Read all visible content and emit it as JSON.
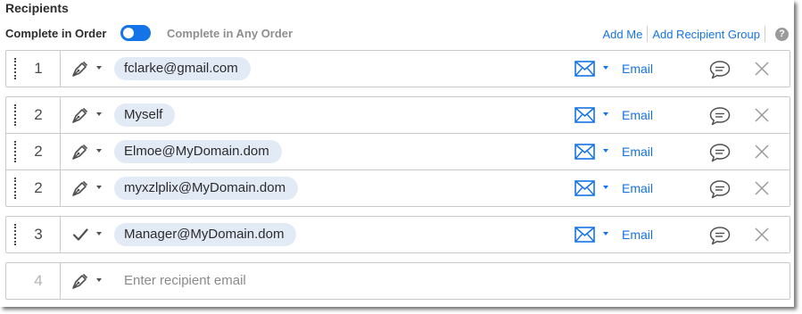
{
  "title": "Recipients",
  "order": {
    "in_order_label": "Complete in Order",
    "any_order_label": "Complete in Any Order"
  },
  "links": {
    "add_me": "Add Me",
    "add_group": "Add Recipient Group",
    "help": "?"
  },
  "colors": {
    "accent": "#1473e6",
    "pill_bg": "#e2eaf6",
    "border": "#c9c9c9"
  },
  "groups": [
    {
      "recipients": [
        {
          "order": "1",
          "role_icon": "signer-pen-icon",
          "email": "fclarke@gmail.com",
          "auth": "Email"
        }
      ]
    },
    {
      "recipients": [
        {
          "order": "2",
          "role_icon": "signer-pen-icon",
          "email": "Myself",
          "auth": "Email"
        },
        {
          "order": "2",
          "role_icon": "signer-pen-icon",
          "email": "Elmoe@MyDomain.dom",
          "auth": "Email"
        },
        {
          "order": "2",
          "role_icon": "signer-pen-icon",
          "email": "myxzlplix@MyDomain.dom",
          "auth": "Email"
        }
      ]
    },
    {
      "recipients": [
        {
          "order": "3",
          "role_icon": "approver-check-icon",
          "email": "Manager@MyDomain.dom",
          "auth": "Email"
        }
      ]
    }
  ],
  "new_recipient": {
    "order": "4",
    "role_icon": "signer-pen-icon",
    "placeholder": "Enter recipient email"
  }
}
